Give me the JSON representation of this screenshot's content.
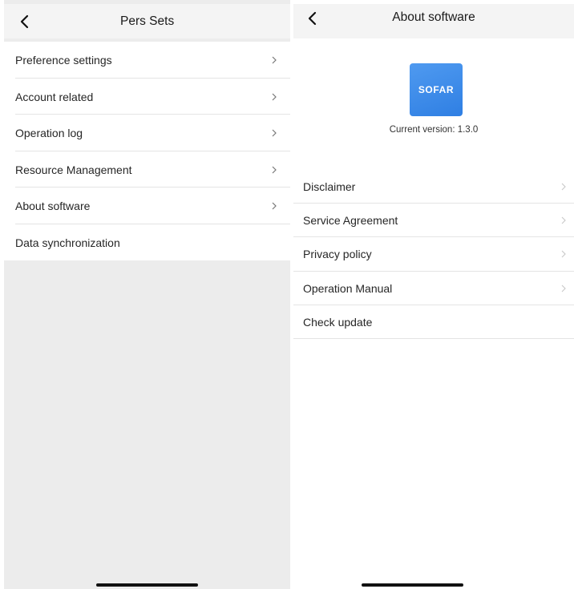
{
  "left_screen": {
    "title": "Pers Sets",
    "back_icon": "chevron-left-icon",
    "items": [
      {
        "label": "Preference settings",
        "has_chevron": true
      },
      {
        "label": "Account related",
        "has_chevron": true
      },
      {
        "label": "Operation log",
        "has_chevron": true
      },
      {
        "label": "Resource Management",
        "has_chevron": true
      },
      {
        "label": "About software",
        "has_chevron": true
      },
      {
        "label": "Data synchronization",
        "has_chevron": false
      }
    ]
  },
  "right_screen": {
    "title": "About software",
    "back_icon": "chevron-left-icon",
    "logo_text": "SOFAR",
    "logo_color": "#3b8ae8",
    "version_text": "Current version: 1.3.0",
    "items": [
      {
        "label": "Disclaimer",
        "has_chevron": true
      },
      {
        "label": "Service Agreement",
        "has_chevron": true
      },
      {
        "label": "Privacy policy",
        "has_chevron": true
      },
      {
        "label": "Operation Manual",
        "has_chevron": true
      },
      {
        "label": "Check update",
        "has_chevron": false
      }
    ]
  },
  "colors": {
    "nav_background": "#f4f4f4",
    "page_background": "#ececec",
    "divider": "#e4e4e4"
  }
}
